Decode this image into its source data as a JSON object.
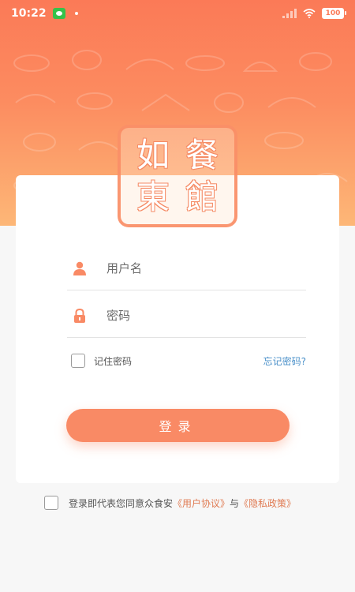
{
  "status_bar": {
    "time": "10:22",
    "app_icon": "wechat-icon",
    "battery": "100"
  },
  "logo": {
    "chars": [
      "如",
      "餐",
      "東",
      "館"
    ]
  },
  "form": {
    "username_placeholder": "用户名",
    "password_placeholder": "密码",
    "remember_label": "记住密码",
    "forgot_label": "忘记密码?",
    "login_label": "登录"
  },
  "agreement": {
    "prefix": "登录即代表您同意众食安",
    "user_agreement": "《用户协议》",
    "connector": "与",
    "privacy_policy": "《隐私政策》"
  },
  "colors": {
    "accent": "#f98a65",
    "link": "#4a90c9",
    "agreement_link": "#e07b53"
  }
}
